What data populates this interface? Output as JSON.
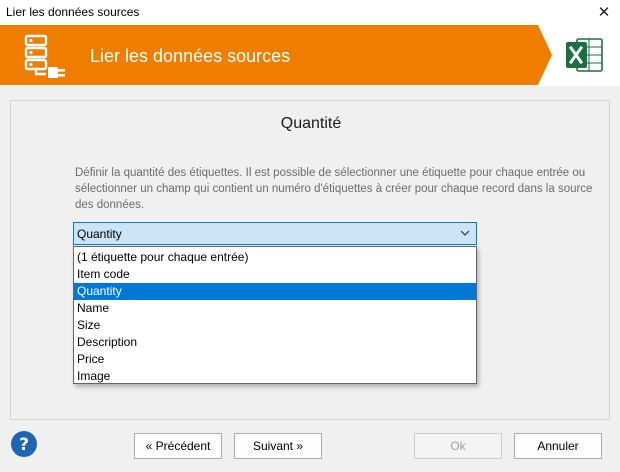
{
  "window": {
    "title": "Lier les données sources",
    "close_glyph": "✕"
  },
  "banner": {
    "title": "Lier les données sources",
    "logo_icon": "database-plug-icon",
    "app_icon": "excel-icon",
    "colors": {
      "orange": "#ef7d00",
      "excel_green": "#1d6f42"
    }
  },
  "main": {
    "heading": "Quantité",
    "description": "Définir la quantité des étiquettes. Il est possible de sélectionner une étiquette pour chaque entrée ou sélectionner un champ qui contient un numéro d'étiquettes à créer pour chaque record dans la source des données.",
    "quantity_select": {
      "value": "Quantity",
      "options": [
        "(1 étiquette pour chaque entrée)",
        "Item code",
        "Quantity",
        "Name",
        "Size",
        "Description",
        "Price",
        "Image"
      ],
      "selected_index": 2
    }
  },
  "footer": {
    "help_icon": "question-mark-icon",
    "previous_label": "« Précédent",
    "next_label": "Suivant »",
    "ok_label": "Ok",
    "cancel_label": "Annuler"
  }
}
